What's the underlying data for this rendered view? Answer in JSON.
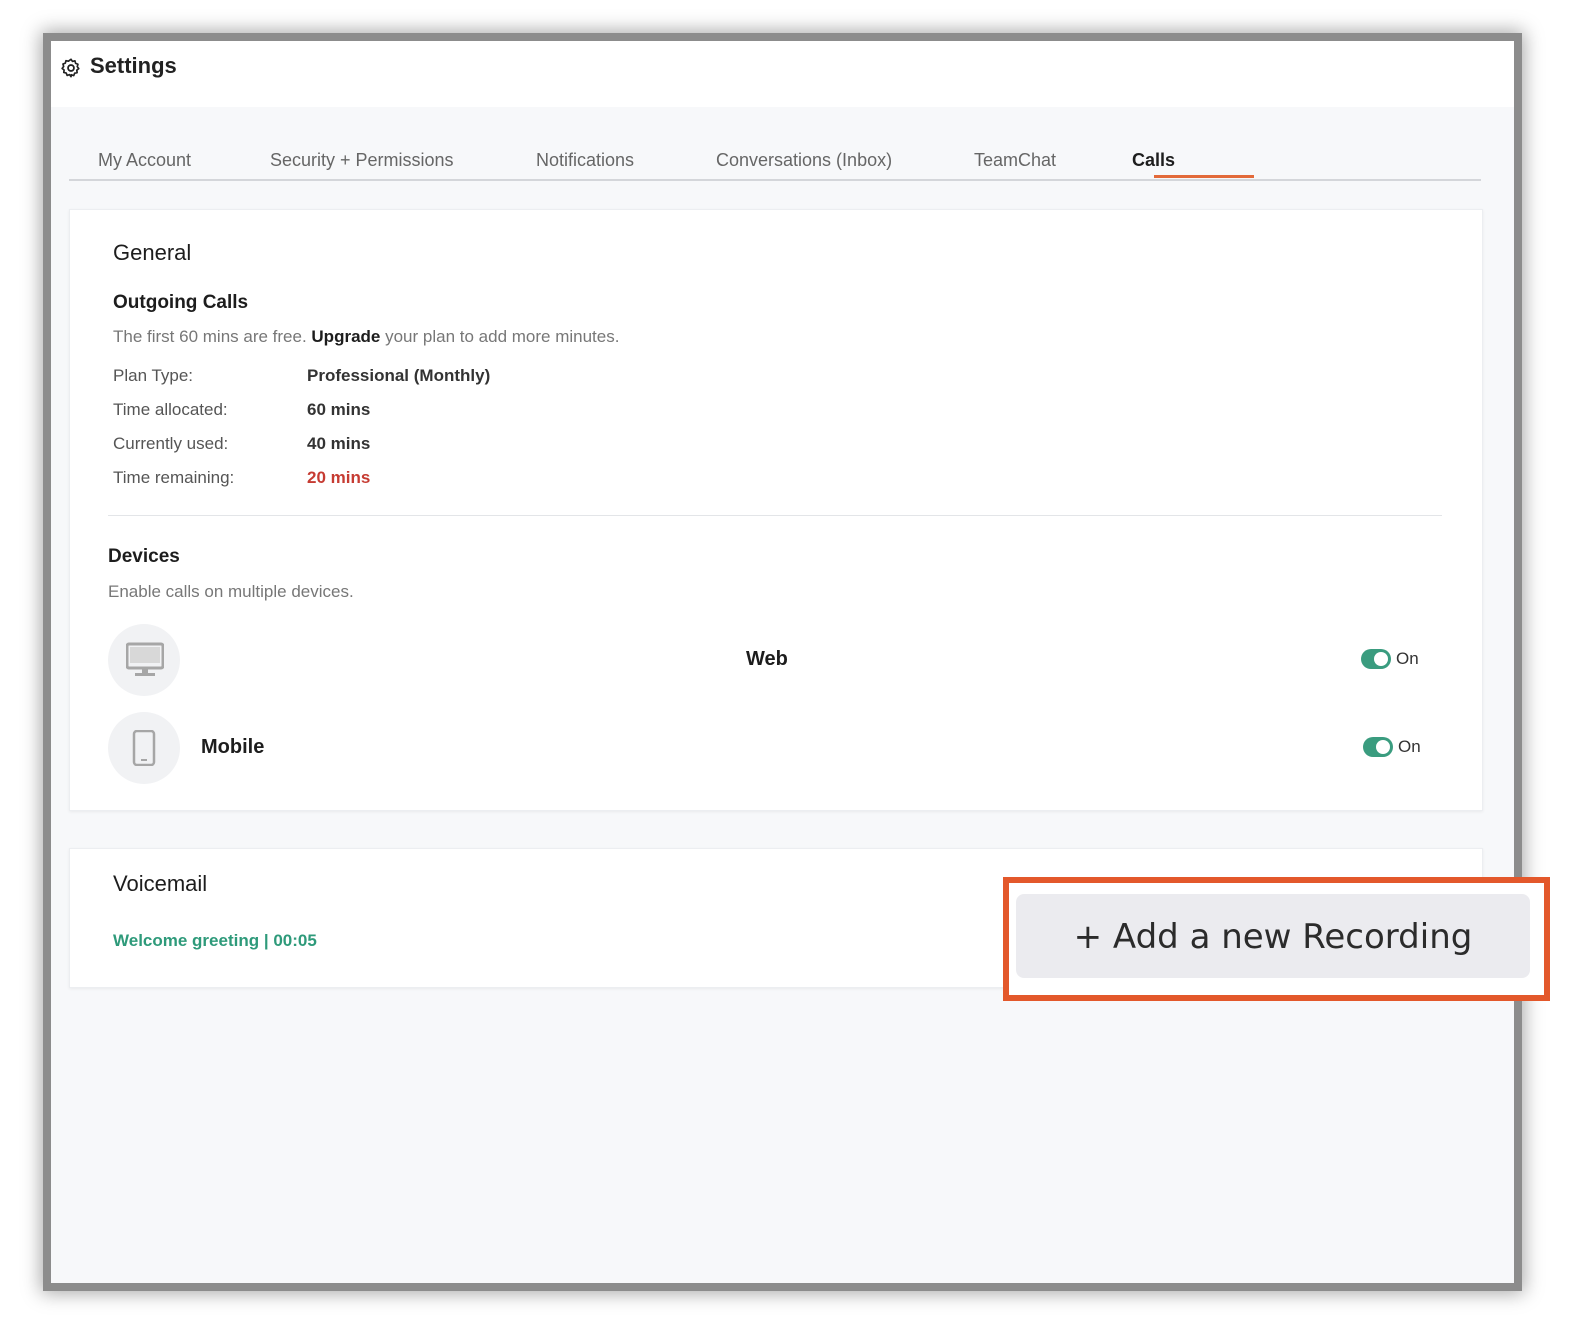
{
  "window": {
    "title": "Settings"
  },
  "tabs": [
    {
      "label": "My Account"
    },
    {
      "label": "Security + Permissions"
    },
    {
      "label": "Notifications"
    },
    {
      "label": "Conversations (Inbox)"
    },
    {
      "label": "TeamChat"
    },
    {
      "label": "Calls",
      "active": true
    }
  ],
  "general": {
    "heading": "General",
    "outgoing": {
      "heading": "Outgoing Calls",
      "note_prefix": "The first 60 mins are free. ",
      "note_link": "Upgrade",
      "note_suffix": " your plan to add more minutes.",
      "rows": [
        {
          "label": "Plan Type:",
          "value": "Professional (Monthly)"
        },
        {
          "label": "Time allocated:",
          "value": "60 mins"
        },
        {
          "label": "Currently used:",
          "value": "40 mins"
        },
        {
          "label": "Time remaining:",
          "value": "20 mins",
          "color": "#c63b32"
        }
      ]
    },
    "devices": {
      "heading": "Devices",
      "note": "Enable calls on multiple devices.",
      "items": [
        {
          "name": "Web",
          "icon": "monitor-icon",
          "toggle_label": "On",
          "enabled": true
        },
        {
          "name": "Mobile",
          "icon": "mobile-phone-icon",
          "toggle_label": "On",
          "enabled": true
        }
      ]
    }
  },
  "voicemail": {
    "heading": "Voicemail",
    "greeting": "Welcome greeting  |  00:05",
    "add_button": "+ Add a new Recording"
  },
  "colors": {
    "accent": "#3a9c7f",
    "tab_active": "#e36a3a",
    "highlight": "#e3582b",
    "warning": "#c63b32"
  }
}
